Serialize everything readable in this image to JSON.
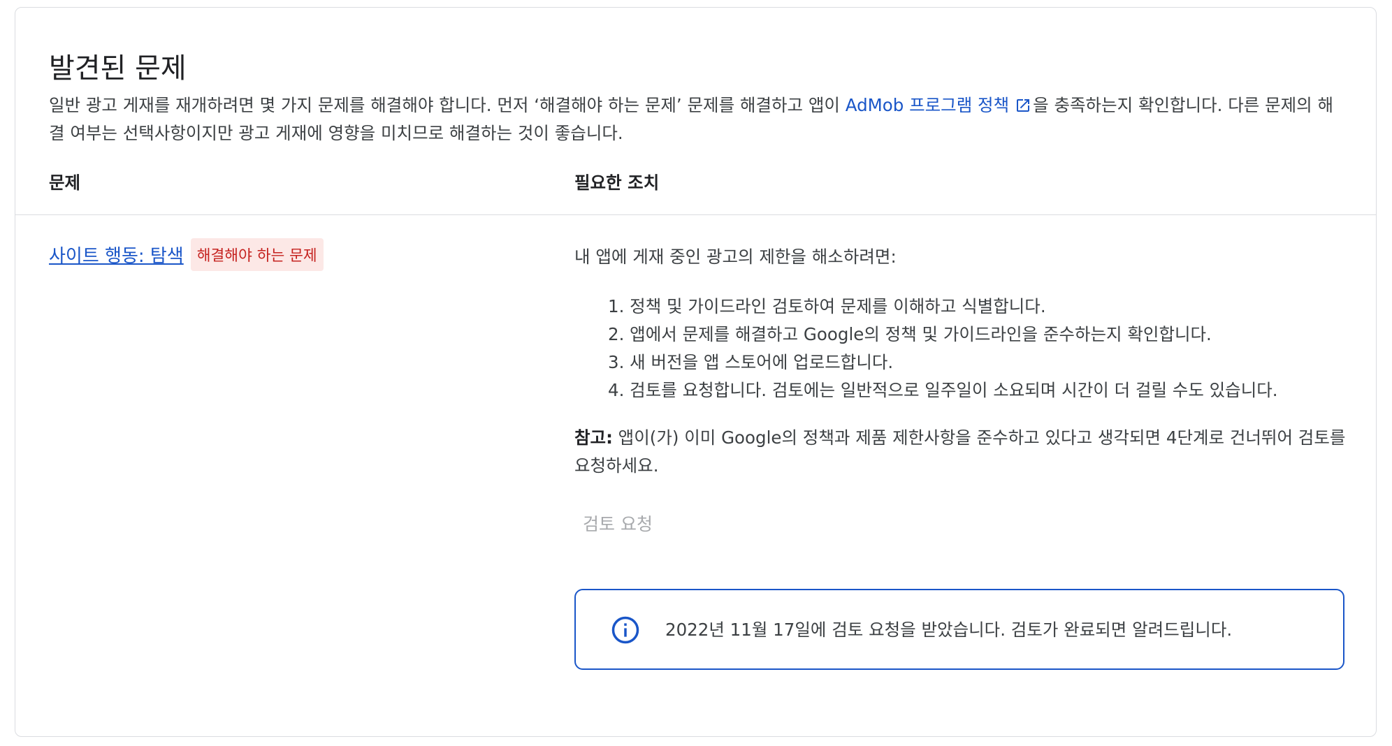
{
  "card": {
    "title": "발견된 문제",
    "description": {
      "part1": "일반 광고 게재를 재개하려면 몇 가지 문제를 해결해야 합니다. 먼저 ‘해결해야 하는 문제’ 문제를 해결하고 앱이 ",
      "policy_link": "AdMob 프로그램 정책",
      "part2": "을 충족하는지 확인합니다. 다른 문제의 해결 여부는 선택사항이지만 광고 게재에 영향을 미치므로 해결하는 것이 좋습니다."
    },
    "columns": {
      "issue": "문제",
      "action": "필요한 조치"
    }
  },
  "issue": {
    "name": "사이트 행동: 탐색",
    "badge": "해결해야 하는 문제",
    "badge_color": "#c5221f"
  },
  "action": {
    "intro": "내 앱에 게재 중인 광고의 제한을 해소하려면:",
    "steps": [
      "1. 정책 및 가이드라인 검토하여 문제를 이해하고 식별합니다.",
      "2. 앱에서 문제를 해결하고 Google의 정책 및 가이드라인을 준수하는지 확인합니다.",
      "3. 새 버전을 앱 스토어에 업로드합니다.",
      "4. 검토를 요청합니다. 검토에는 일반적으로 일주일이 소요되며 시간이 더 걸릴 수도 있습니다."
    ],
    "note_label": "참고:",
    "note_text": " 앱이(가) 이미 Google의 정책과 제품 제한사항을 준수하고 있다고 생각되면 4단계로 건너뛰어 검토를 요청하세요.",
    "review_button": "검토 요청",
    "info_message": "2022년 11월 17일에 검토 요청을 받았습니다. 검토가 완료되면 알려드립니다."
  },
  "colors": {
    "link": "#1a56c8",
    "border": "#dadce0",
    "disabled": "#a7a9ac"
  },
  "icons": {
    "external_link": "open-in-new-icon",
    "info": "info-circle-icon"
  }
}
